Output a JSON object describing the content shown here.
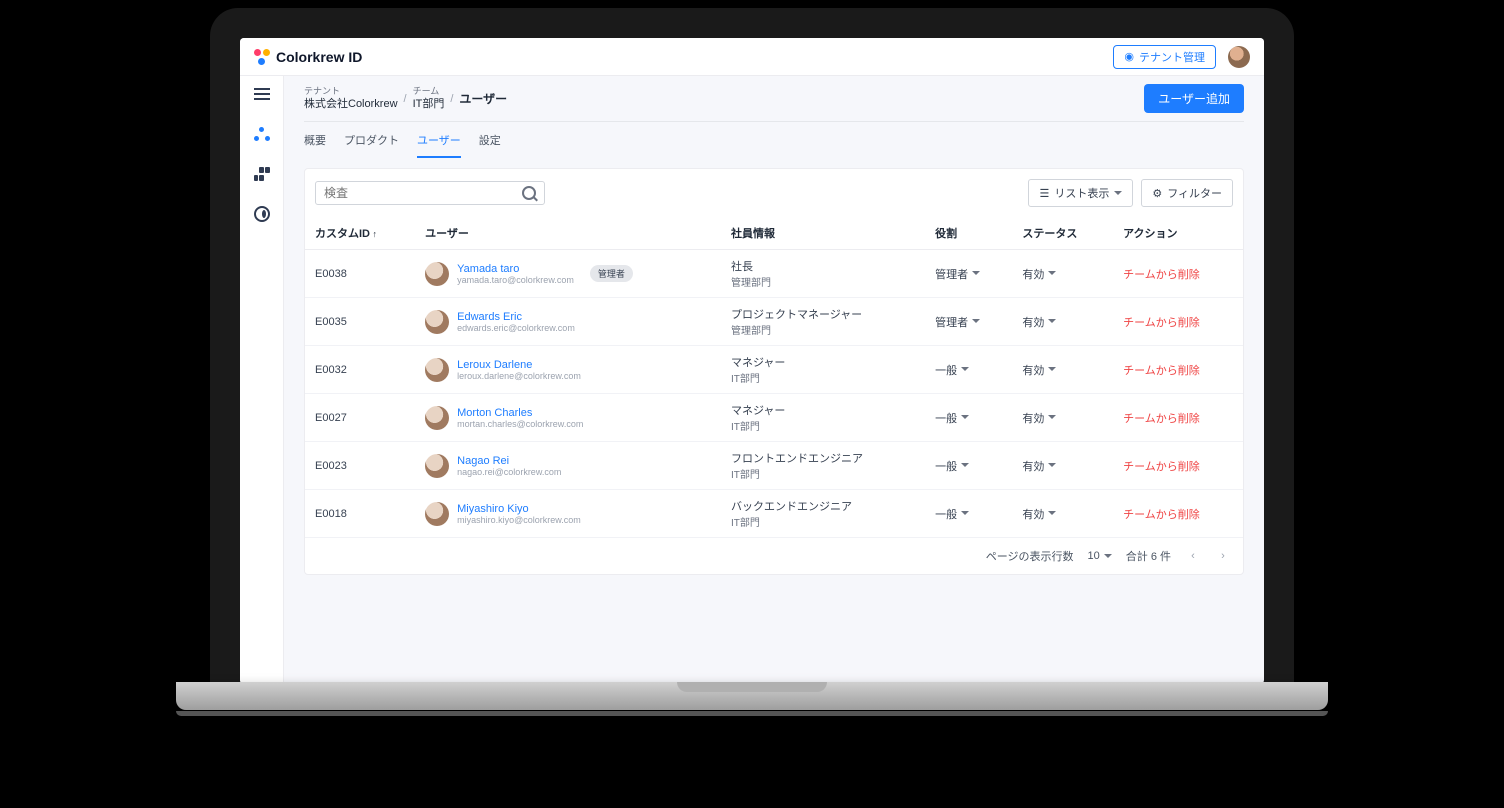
{
  "brand": "Colorkrew ID",
  "header": {
    "tenant_button": "テナント管理"
  },
  "breadcrumb": {
    "l1_label": "テナント",
    "l1_value": "株式会社Colorkrew",
    "l2_label": "チーム",
    "l2_value": "IT部門",
    "current": "ユーザー"
  },
  "actions": {
    "add_user": "ユーザー追加"
  },
  "tabs": [
    {
      "label": "概要"
    },
    {
      "label": "プロダクト"
    },
    {
      "label": "ユーザー",
      "active": true
    },
    {
      "label": "設定"
    }
  ],
  "toolbar": {
    "search_placeholder": "検査",
    "view_label": "リスト表示",
    "filter_label": "フィルター"
  },
  "columns": {
    "custom_id": "カスタムID",
    "user": "ユーザー",
    "emp": "社員情報",
    "role": "役割",
    "status": "ステータス",
    "action": "アクション"
  },
  "rows": [
    {
      "id": "E0038",
      "name": "Yamada taro",
      "email": "yamada.taro@colorkrew.com",
      "badge": "管理者",
      "title": "社長",
      "dept": "管理部門",
      "role": "管理者",
      "status": "有効",
      "action": "チームから削除"
    },
    {
      "id": "E0035",
      "name": "Edwards Eric",
      "email": "edwards.eric@colorkrew.com",
      "title": "プロジェクトマネージャー",
      "dept": "管理部門",
      "role": "管理者",
      "status": "有効",
      "action": "チームから削除"
    },
    {
      "id": "E0032",
      "name": "Leroux Darlene",
      "email": "leroux.darlene@colorkrew.com",
      "title": "マネジャー",
      "dept": "IT部門",
      "role": "一般",
      "status": "有効",
      "action": "チームから削除"
    },
    {
      "id": "E0027",
      "name": "Morton Charles",
      "email": "mortan.charles@colorkrew.com",
      "title": "マネジャー",
      "dept": "IT部門",
      "role": "一般",
      "status": "有効",
      "action": "チームから削除"
    },
    {
      "id": "E0023",
      "name": "Nagao Rei",
      "email": "nagao.rei@colorkrew.com",
      "title": "フロントエンドエンジニア",
      "dept": "IT部門",
      "role": "一般",
      "status": "有効",
      "action": "チームから削除"
    },
    {
      "id": "E0018",
      "name": "Miyashiro Kiyo",
      "email": "miyashiro.kiyo@colorkrew.com",
      "title": "バックエンドエンジニア",
      "dept": "IT部門",
      "role": "一般",
      "status": "有効",
      "action": "チームから削除"
    }
  ],
  "pager": {
    "rows_label": "ページの表示行数",
    "rows_value": "10",
    "total_label": "合計 6 件"
  }
}
